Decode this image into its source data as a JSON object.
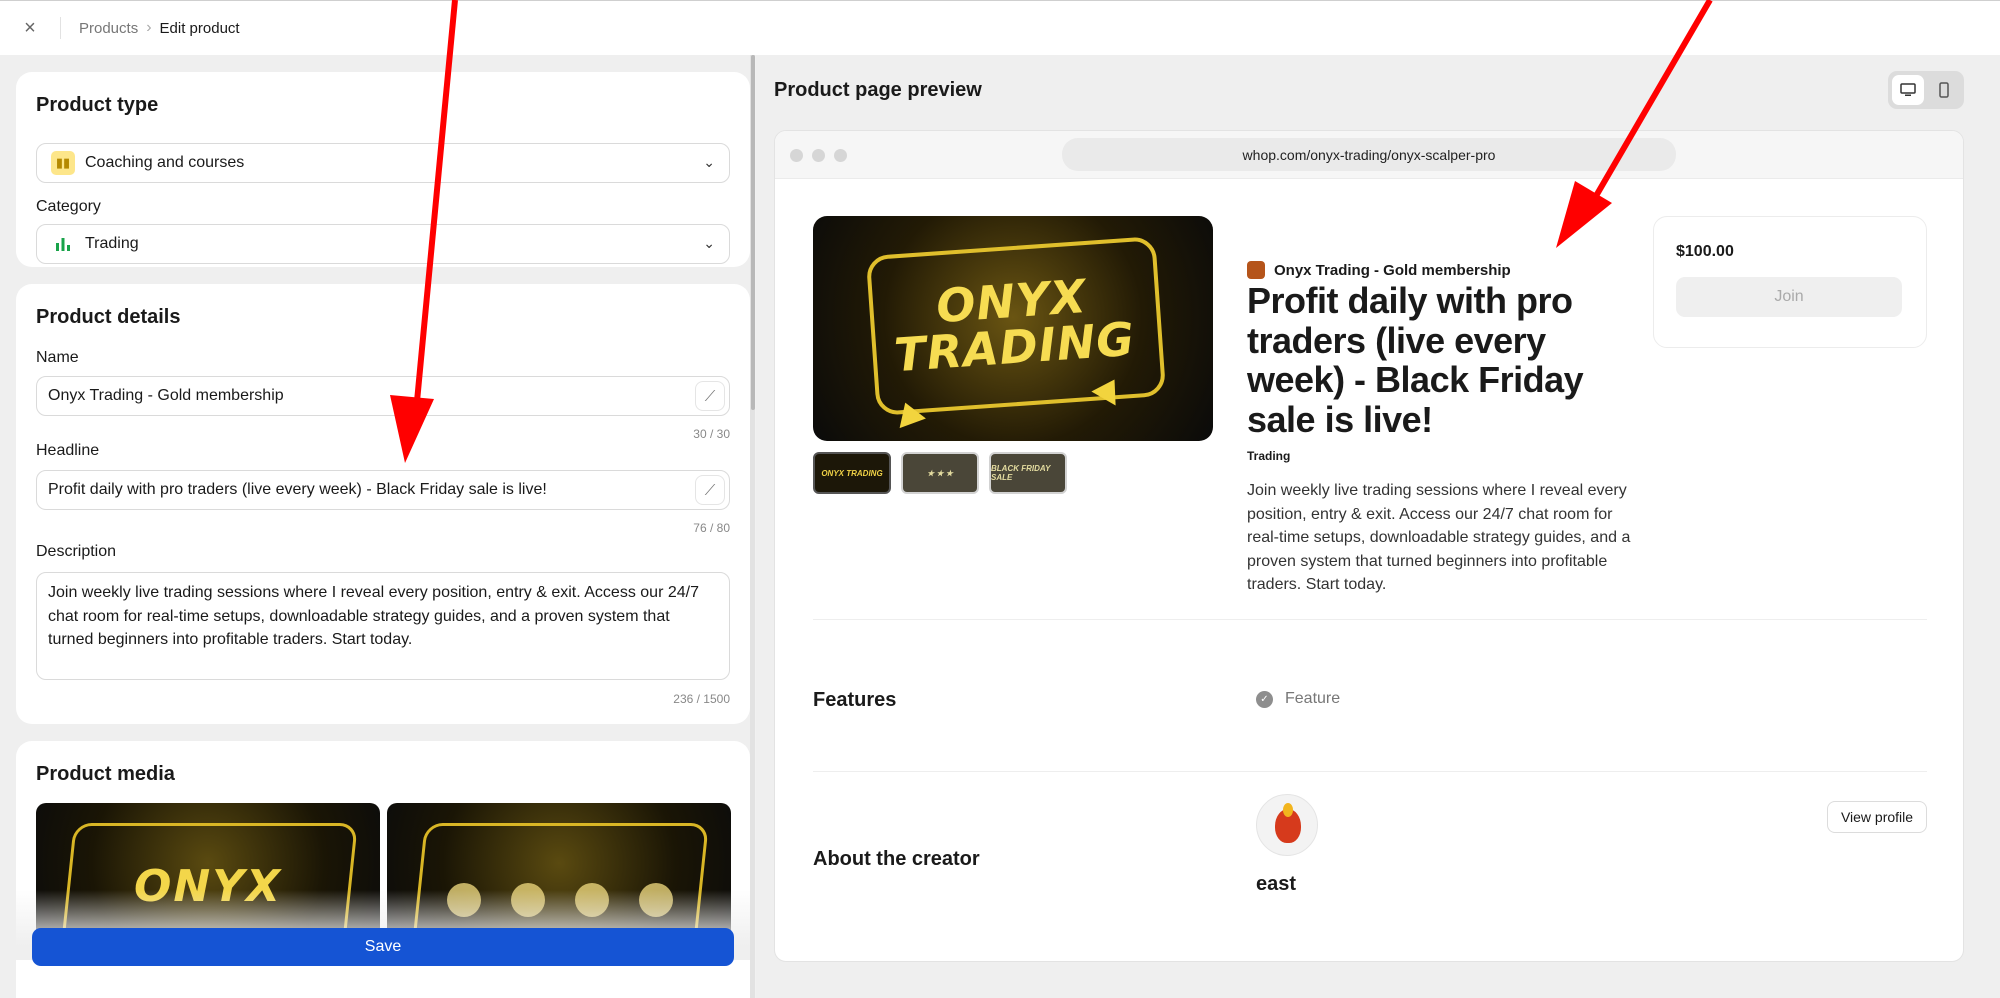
{
  "topbar": {
    "close_icon": "×",
    "breadcrumb": [
      "Products",
      "Edit product"
    ],
    "sep": "›"
  },
  "product_type": {
    "title": "Product type",
    "type_value": "Coaching and courses",
    "category_label": "Category",
    "category_value": "Trading"
  },
  "product_details": {
    "title": "Product details",
    "name_label": "Name",
    "name_value": "Onyx Trading - Gold membership",
    "name_count": "30 / 30",
    "headline_label": "Headline",
    "headline_value": "Profit daily with pro traders (live every week) - Black Friday sale is live!",
    "headline_count": "76 / 80",
    "description_label": "Description",
    "description_value": "Join weekly live trading sessions where I reveal every position, entry & exit. Access our 24/7 chat room for real-time setups, downloadable strategy guides, and a proven system that turned beginners into profitable traders. Start today.",
    "description_count": "236 / 1500"
  },
  "product_media": {
    "title": "Product media",
    "thumb_text": "ONYX"
  },
  "save_label": "Save",
  "preview": {
    "title": "Product page preview",
    "url": "whop.com/onyx-trading/onyx-scalper-pro",
    "hero_logo_line1": "ONYX",
    "hero_logo_line2": "TRADING",
    "thumb_labels": [
      "ONYX TRADING",
      "★ ★ ★",
      "BLACK FRIDAY SALE"
    ],
    "store_name": "Onyx Trading - Gold membership",
    "headline": "Profit daily with pro traders (live every week) - Black Friday sale is live!",
    "category": "Trading",
    "description": "Join weekly live trading sessions where I reveal every position, entry & exit. Access our 24/7 chat room for real-time setups, downloadable strategy guides, and a proven system that turned beginners into profitable traders. Start today.",
    "price": "$100.00",
    "join_label": "Join",
    "features_title": "Features",
    "feature_item": "Feature",
    "about_title": "About the creator",
    "creator_name": "east",
    "view_profile_label": "View profile"
  },
  "colors": {
    "accent": "#1554d4",
    "annotation_arrow": "#ff0000",
    "gold": "#e0bf2c"
  }
}
